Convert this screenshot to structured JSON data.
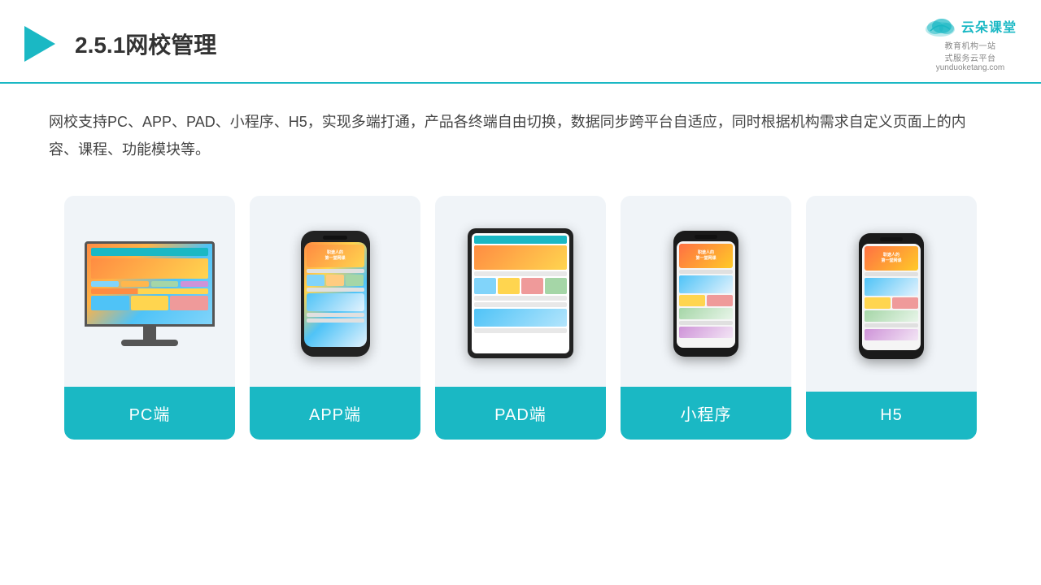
{
  "header": {
    "title": "2.5.1网校管理",
    "logo_name": "云朵课堂",
    "logo_url": "yunduoketang.com",
    "logo_tagline": "教育机构一站\n式服务云平台"
  },
  "description": {
    "text": "网校支持PC、APP、PAD、小程序、H5，实现多端打通，产品各终端自由切换，数据同步跨平台自适应，同时根据机构需求自定义页面上的内容、课程、功能模块等。"
  },
  "cards": [
    {
      "id": "pc",
      "label": "PC端"
    },
    {
      "id": "app",
      "label": "APP端"
    },
    {
      "id": "pad",
      "label": "PAD端"
    },
    {
      "id": "miniprogram",
      "label": "小程序"
    },
    {
      "id": "h5",
      "label": "H5"
    }
  ],
  "colors": {
    "primary": "#1ab8c4",
    "accent_orange": "#ff8c42",
    "accent_yellow": "#ffd54f",
    "bg_card": "#eef2f7",
    "text_dark": "#333333",
    "text_gray": "#888888"
  }
}
